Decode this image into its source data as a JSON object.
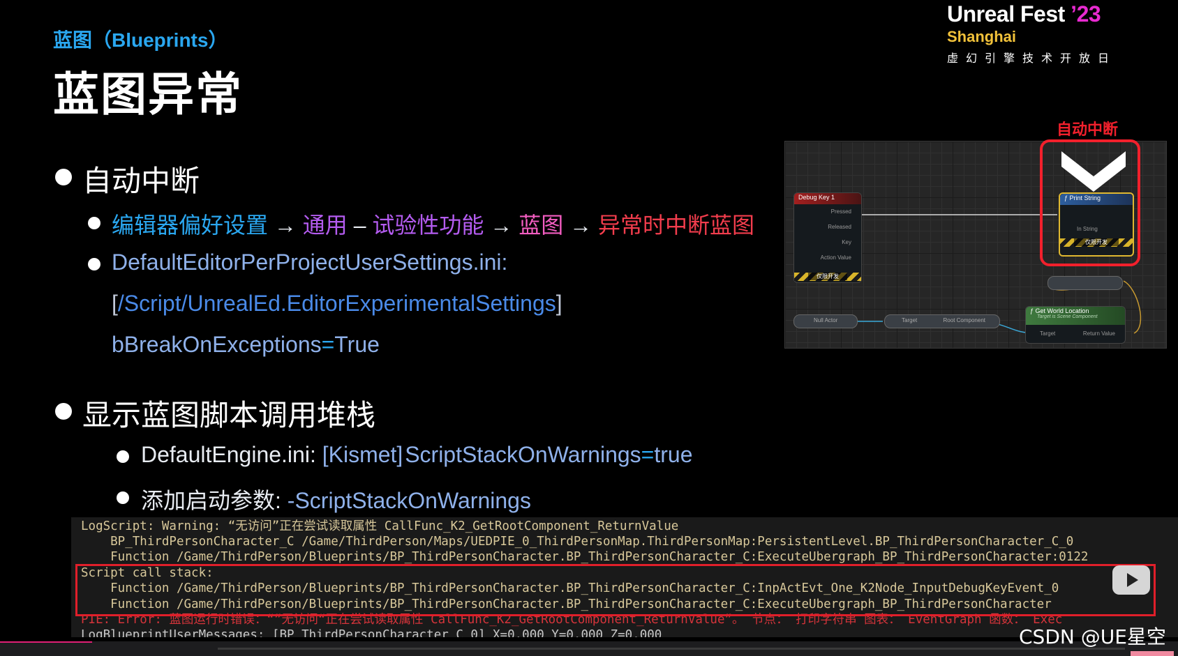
{
  "slide": {
    "subtitle": "蓝图（Blueprints）",
    "title": "蓝图异常"
  },
  "logo": {
    "line1": "Unreal Fest",
    "year": "’23",
    "city": "Shanghai",
    "tagline": "虚幻引擎技术开放日"
  },
  "section1": {
    "heading": "自动中断",
    "path": {
      "editor_prefs": "编辑器偏好设置",
      "arrow": "→",
      "general": "通用",
      "dash": "–",
      "experimental": "试验性功能",
      "blueprints": "蓝图",
      "break_on_exception": "异常时中断蓝图"
    },
    "ini_file": "DefaultEditorPerProjectUserSettings.ini:",
    "ini_section_open": "[",
    "ini_section": "/Script/UnrealEd.EditorExperimentalSettings",
    "ini_section_close": "]",
    "ini_key": "bBreakOnExceptions",
    "ini_eq": "=",
    "ini_value": "True"
  },
  "section2": {
    "heading": "显示蓝图脚本调用堆栈",
    "engine_ini_file": "DefaultEngine.ini:",
    "engine_ini_section": "[Kismet]",
    "engine_ini_key": "ScriptStackOnWarnings",
    "engine_ini_eq": "=",
    "engine_ini_value": "true",
    "launch_label": "添加启动参数:",
    "launch_arg": "-ScriptStackOnWarnings"
  },
  "blueprint_graph": {
    "auto_break_label": "自动中断",
    "debug_key_node": {
      "title": "Debug Key 1",
      "pins": [
        "Pressed",
        "Released",
        "Key",
        "Action Value"
      ],
      "dev_only": "仅限开发"
    },
    "print_string_node": {
      "title": "Print String",
      "pin_in_string": "In String",
      "dev_only": "仅限开发"
    },
    "get_world_location_node": {
      "title": "Get World Location",
      "subtitle": "Target is Scene Component",
      "pin_target": "Target",
      "pin_return": "Return Value"
    },
    "null_actor_pill": "Null Actor",
    "root_component_target": "Target",
    "root_component_label": "Root Component"
  },
  "log": {
    "lines": [
      "LogScript: Warning: “无访问”正在尝试读取属性 CallFunc_K2_GetRootComponent_ReturnValue",
      "    BP_ThirdPersonCharacter_C /Game/ThirdPerson/Maps/UEDPIE_0_ThirdPersonMap.ThirdPersonMap:PersistentLevel.BP_ThirdPersonCharacter_C_0",
      "    Function /Game/ThirdPerson/Blueprints/BP_ThirdPersonCharacter.BP_ThirdPersonCharacter_C:ExecuteUbergraph_BP_ThirdPersonCharacter:0122",
      "Script call stack:",
      "    Function /Game/ThirdPerson/Blueprints/BP_ThirdPersonCharacter.BP_ThirdPersonCharacter_C:InpActEvt_One_K2Node_InputDebugKeyEvent_0",
      "    Function /Game/ThirdPerson/Blueprints/BP_ThirdPersonCharacter.BP_ThirdPersonCharacter_C:ExecuteUbergraph_BP_ThirdPersonCharacter",
      "PIE: Error: 蓝图运行时错误：“”无访问“正在尝试读取属性 CallFunc_K2_GetRootComponent_ReturnValue”。 节点： 打印字符串 图表： EventGraph 函数： Exec",
      "LogBlueprintUserMessages: [BP_ThirdPersonCharacter_C_0] X=0.000 Y=0.000 Z=0.000"
    ]
  },
  "watermark": "CSDN @UE星空",
  "colors": {
    "accent_blue": "#2aa7f0",
    "violet": "#b45cf0",
    "pink": "#f35dc1",
    "red": "#f33d4d",
    "highlight_box": "#f2202c"
  }
}
